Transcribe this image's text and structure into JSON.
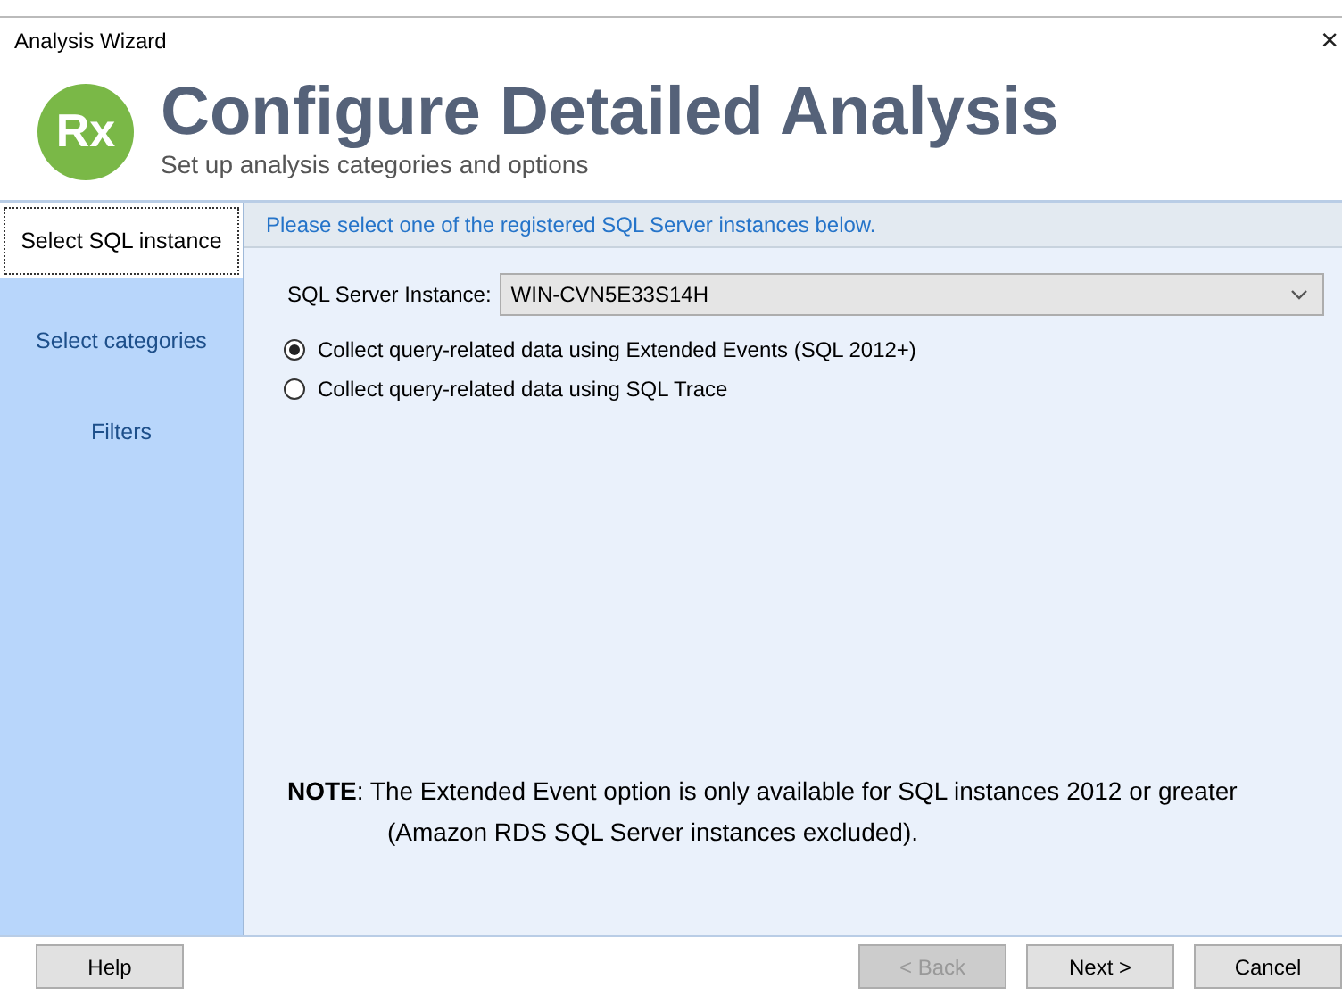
{
  "window": {
    "title": "Analysis Wizard",
    "close": "×"
  },
  "header": {
    "logo": "Rx",
    "title": "Configure Detailed Analysis",
    "subtitle": "Set up analysis categories and options"
  },
  "sidebar": {
    "items": [
      {
        "label": "Select SQL instance",
        "selected": true
      },
      {
        "label": "Select categories",
        "selected": false
      },
      {
        "label": "Filters",
        "selected": false
      }
    ]
  },
  "content": {
    "instruction": "Please select one of the registered SQL Server instances below.",
    "instance_field": {
      "label": "SQL Server Instance:",
      "value": "WIN-CVN5E33S14H"
    },
    "options": [
      {
        "label": "Collect query-related data using Extended Events (SQL 2012+)",
        "selected": true
      },
      {
        "label": "Collect query-related data using SQL Trace",
        "selected": false
      }
    ],
    "note_lines": [
      "**NOTE**: The Extended Event option is only available for SQL instances 2012 or greater",
      "(Amazon RDS SQL Server instances excluded)."
    ]
  },
  "buttons": [
    {
      "label": "Help",
      "disabled": false
    },
    {
      "label": "< Back",
      "disabled": true
    },
    {
      "label": "Next >",
      "disabled": false
    },
    {
      "label": "Cancel",
      "disabled": false
    }
  ]
}
